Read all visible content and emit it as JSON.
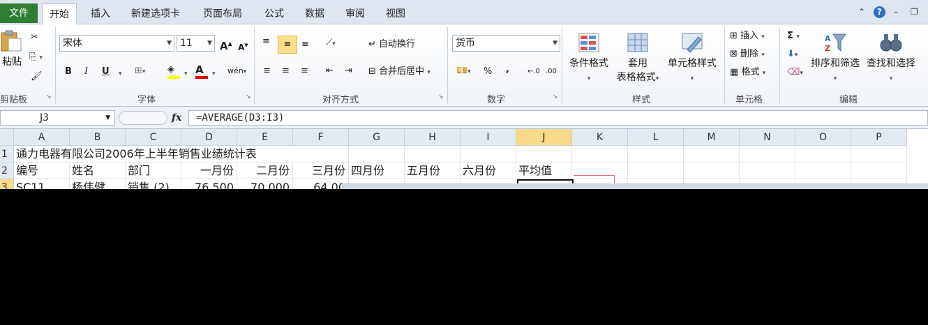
{
  "tabs": {
    "file": "文件",
    "items": [
      "开始",
      "插入",
      "新建选项卡",
      "页面布局",
      "公式",
      "数据",
      "审阅",
      "视图"
    ],
    "active": "开始"
  },
  "window_controls": {
    "up": "⌃",
    "help": "?",
    "minimize": "–",
    "restore": "❐"
  },
  "ribbon": {
    "clipboard": {
      "paste": "粘贴",
      "label": "剪贴板"
    },
    "font": {
      "name": "宋体",
      "size": "11",
      "grow": "A",
      "shrink": "A",
      "bold": "B",
      "italic": "I",
      "underline": "U",
      "color_letter": "A",
      "phonetic": "wén",
      "label": "字体",
      "highlight_color": "#ffff00",
      "font_color": "#e00000"
    },
    "alignment": {
      "wrap": "自动换行",
      "merge": "合并后居中",
      "label": "对齐方式"
    },
    "number": {
      "format": "货币",
      "percent": "%",
      "comma": ",",
      "label": "数字"
    },
    "styles": {
      "conditional": "条件格式",
      "table_line1": "套用",
      "table_line2": "表格格式",
      "cell_styles": "单元格样式",
      "label": "样式"
    },
    "cells": {
      "insert": "插入",
      "delete": "删除",
      "format": "格式",
      "label": "单元格"
    },
    "editing": {
      "sum": "Σ",
      "sort": "排序和筛选",
      "find": "查找和选择",
      "label": "编辑"
    }
  },
  "formula_bar": {
    "name_box": "J3",
    "fx": "fx",
    "formula": "=AVERAGE(D3:I3)"
  },
  "grid": {
    "columns": [
      "A",
      "B",
      "C",
      "D",
      "E",
      "F",
      "G",
      "H",
      "I",
      "J",
      "K",
      "L",
      "M",
      "N",
      "O",
      "P"
    ],
    "selected_column": "J",
    "rows": [
      {
        "num": "1",
        "cells": [
          "通力电器有限公司2006年上半年销售业绩统计表",
          "",
          "",
          "",
          "",
          "",
          "",
          "",
          "",
          "",
          "",
          "",
          "",
          "",
          "",
          ""
        ]
      },
      {
        "num": "2",
        "cells": [
          "编号",
          "姓名",
          "部门",
          "一月份",
          "二月份",
          "三月份",
          "四月份",
          "五月份",
          "六月份",
          "平均值",
          "",
          "",
          "",
          "",
          "",
          ""
        ]
      },
      {
        "num": "3",
        "cells": [
          "SC11",
          "杨伟健",
          "销售 (2)",
          "76,500",
          "70,000",
          "64,00",
          "",
          "",
          "",
          "",
          "",
          "",
          "",
          "",
          "",
          ""
        ]
      }
    ],
    "numeric_columns": [
      3,
      4,
      5
    ]
  }
}
